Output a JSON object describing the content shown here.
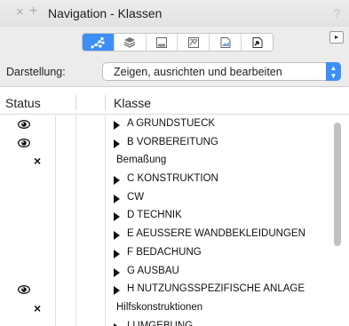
{
  "window": {
    "title": "Navigation - Klassen",
    "close_glyph": "×",
    "add_glyph": "+",
    "help_glyph": "?"
  },
  "toolbar": {
    "active_color": "#3d8ef7",
    "buttons": [
      {
        "icon": "class-hierarchy-icon",
        "active": true
      },
      {
        "icon": "layers-icon",
        "active": false
      },
      {
        "icon": "sheet-layer-icon",
        "active": false
      },
      {
        "icon": "saved-view-icon",
        "active": false
      },
      {
        "icon": "viewport-icon",
        "active": false
      },
      {
        "icon": "reference-icon",
        "active": false
      }
    ],
    "expand_glyph": "▸"
  },
  "display": {
    "label": "Darstellung:",
    "value": "Zeigen, ausrichten und bearbeiten"
  },
  "table": {
    "headers": {
      "status": "Status",
      "class": "Klasse"
    },
    "rows": [
      {
        "visible": true,
        "excluded": false,
        "expandable": true,
        "name": "A GRUNDSTUECK"
      },
      {
        "visible": true,
        "excluded": false,
        "expandable": true,
        "name": "B VORBEREITUNG"
      },
      {
        "visible": false,
        "excluded": true,
        "expandable": false,
        "name": "Bemaßung"
      },
      {
        "visible": false,
        "excluded": false,
        "expandable": true,
        "name": "C KONSTRUKTION"
      },
      {
        "visible": false,
        "excluded": false,
        "expandable": true,
        "name": "CW"
      },
      {
        "visible": false,
        "excluded": false,
        "expandable": true,
        "name": "D TECHNIK"
      },
      {
        "visible": false,
        "excluded": false,
        "expandable": true,
        "name": "E AEUSSERE WANDBEKLEIDUNGEN"
      },
      {
        "visible": false,
        "excluded": false,
        "expandable": true,
        "name": "F BEDACHUNG"
      },
      {
        "visible": false,
        "excluded": false,
        "expandable": true,
        "name": "G AUSBAU"
      },
      {
        "visible": true,
        "excluded": false,
        "expandable": true,
        "name": "H NUTZUNGSSPEZIFISCHE ANLAGE"
      },
      {
        "visible": false,
        "excluded": true,
        "expandable": false,
        "name": "Hilfskonstruktionen"
      },
      {
        "visible": false,
        "excluded": false,
        "expandable": true,
        "name": "I UMGEBUNG"
      }
    ]
  },
  "status_glyphs": {
    "excluded": "×"
  }
}
